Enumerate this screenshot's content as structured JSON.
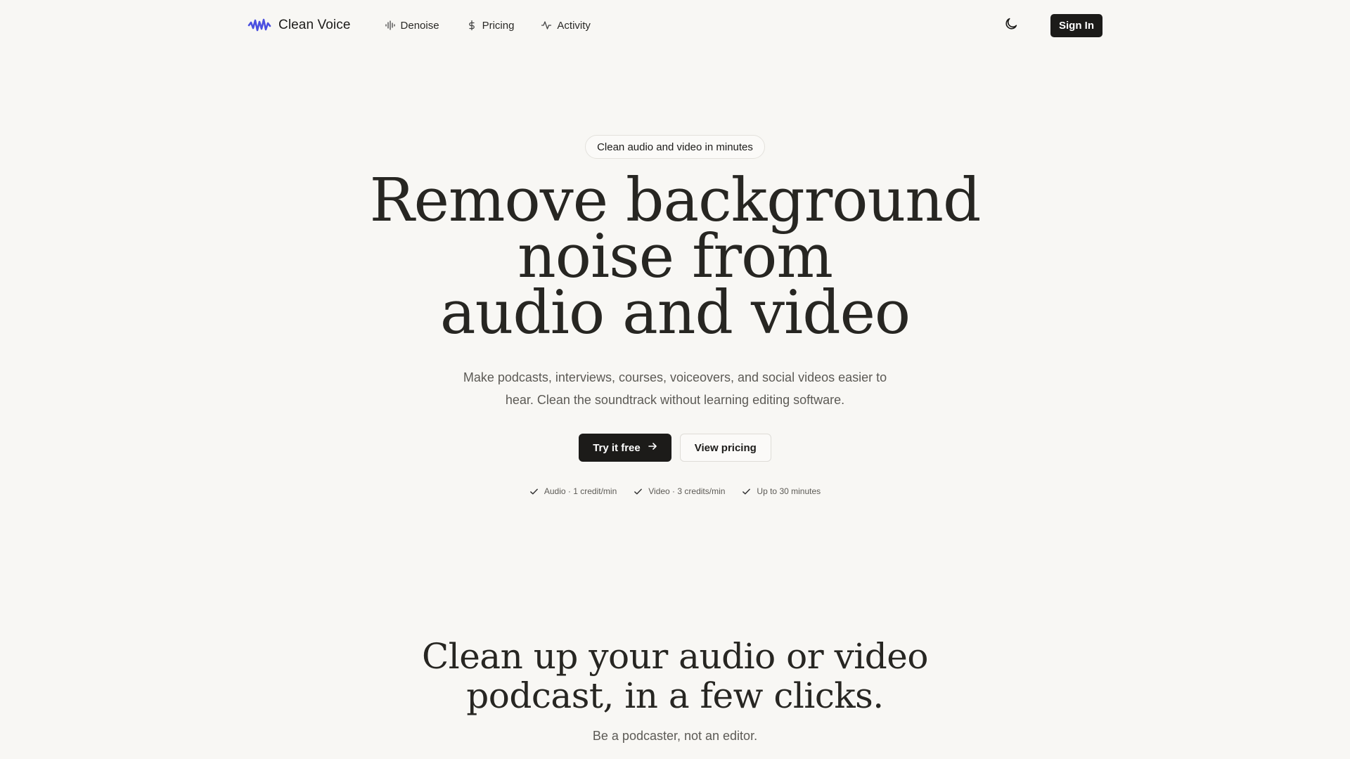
{
  "nav": {
    "brand": "Clean Voice",
    "brand_icon": "waveform-logo-icon",
    "links": [
      {
        "label": "Denoise",
        "icon": "audio-lines-icon"
      },
      {
        "label": "Pricing",
        "icon": "dollar-icon"
      },
      {
        "label": "Activity",
        "icon": "activity-icon"
      }
    ],
    "theme_icon": "moon-icon",
    "signin_label": "Sign In"
  },
  "hero": {
    "badge": "Clean audio and video in minutes",
    "title_lines": [
      "Remove background",
      "noise from",
      "audio and video"
    ],
    "subtitle_lines": [
      "Make podcasts, interviews, courses, voiceovers, and social videos easier to",
      "hear. Clean the soundtrack without learning editing software."
    ],
    "primary_cta": "Try it free",
    "secondary_cta": "View pricing",
    "features": [
      "Audio · 1 credit/min",
      "Video · 3 credits/min",
      "Up to 30 minutes"
    ]
  },
  "section2": {
    "title_lines": [
      "Clean up your audio or video",
      "podcast, in a few clicks."
    ],
    "subtitle": "Be a podcaster, not an editor."
  },
  "colors": {
    "background": "#f8f7f4",
    "brand_accent": "#4a4fe0",
    "primary_button": "#1c1b19",
    "text": "#1c1b19",
    "muted_text": "#5c5a55"
  }
}
